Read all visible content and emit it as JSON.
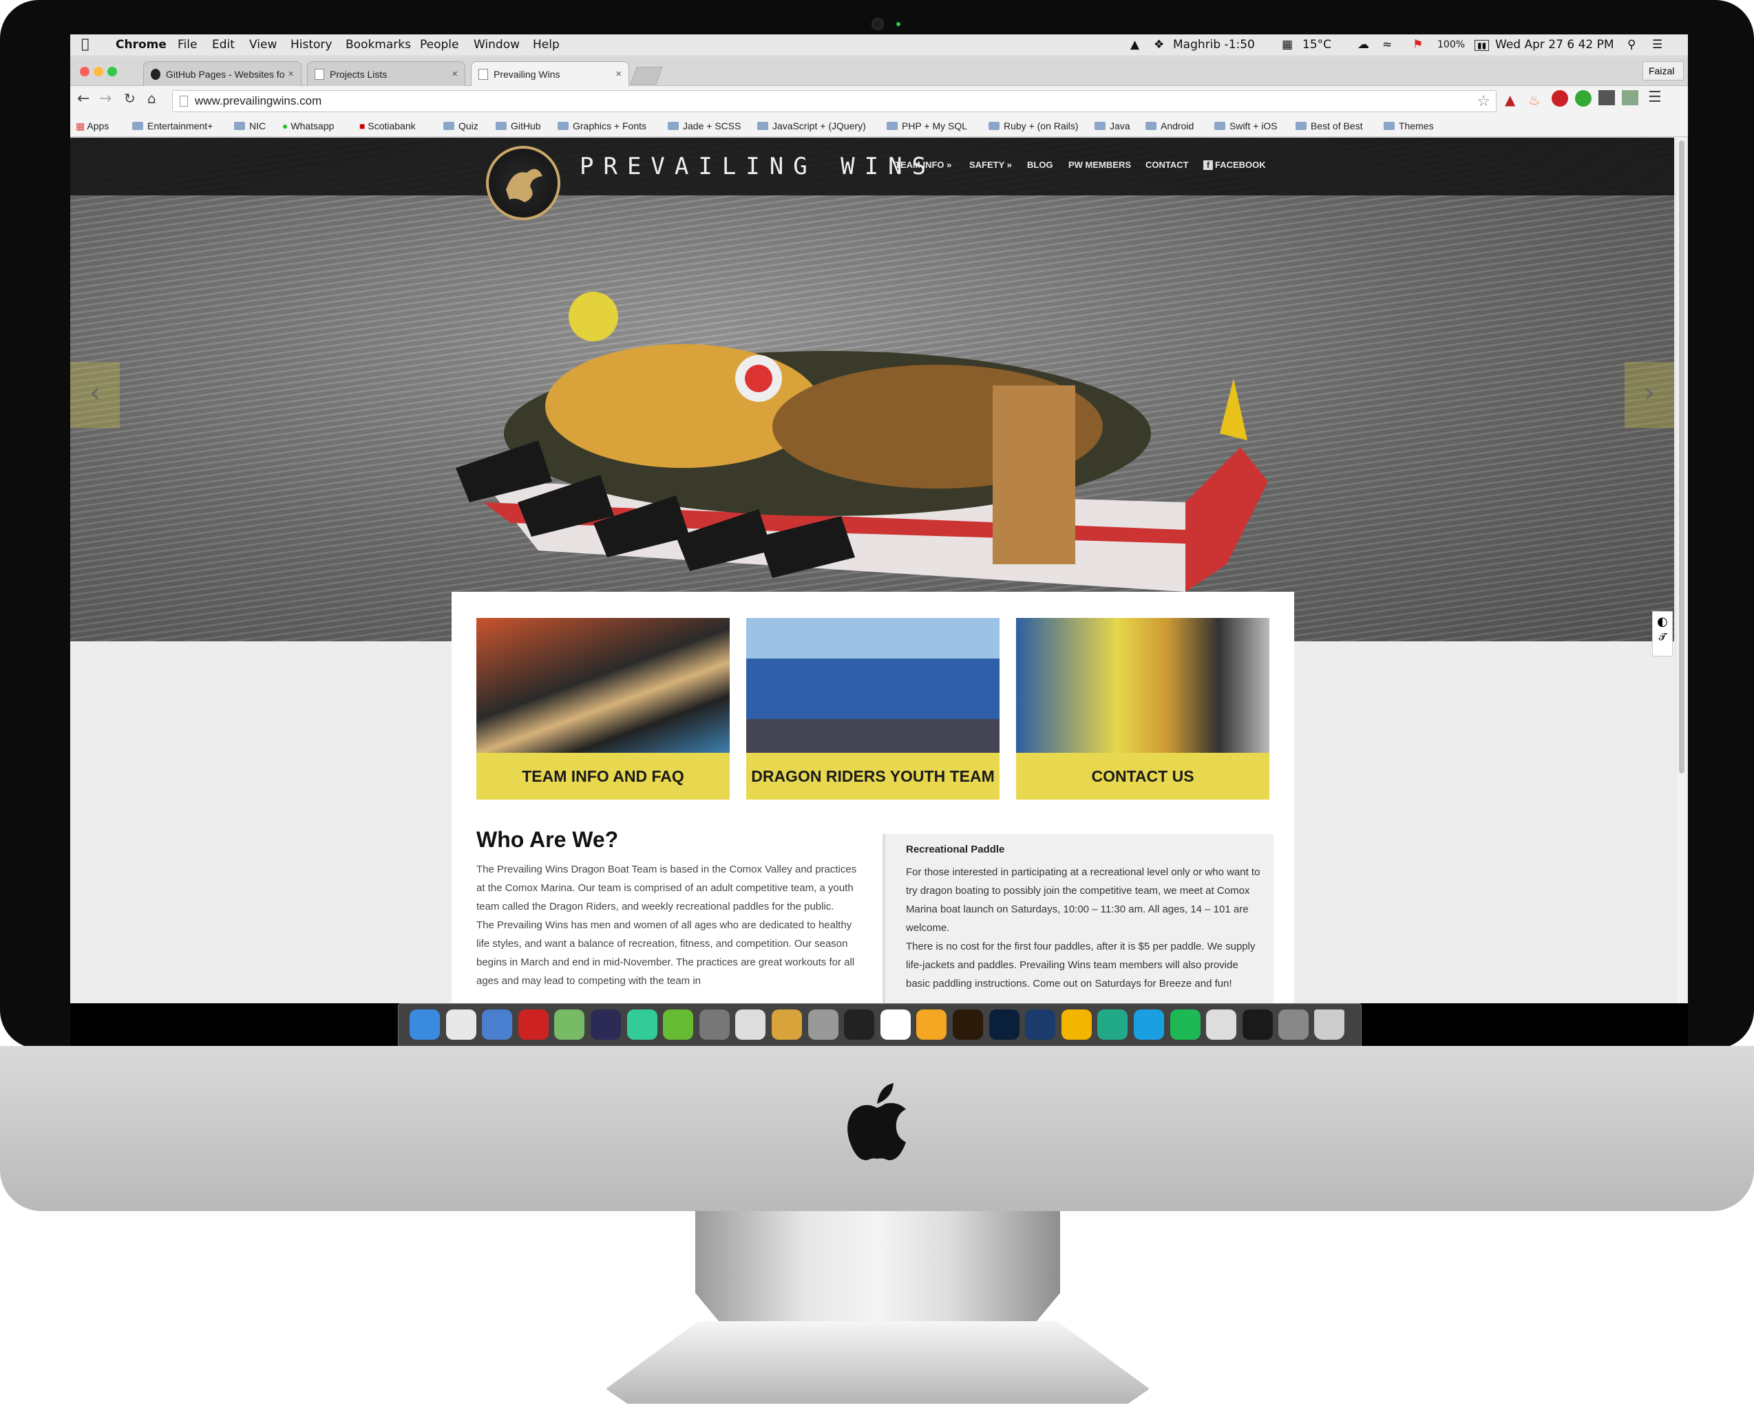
{
  "menubar": {
    "app": "Chrome",
    "menus": [
      "File",
      "Edit",
      "View",
      "History",
      "Bookmarks",
      "People",
      "Window",
      "Help"
    ],
    "prayer": "Maghrib -1:50",
    "weather": "15°C",
    "battery": "100%",
    "datetime": "Wed Apr 27  6 42 PM"
  },
  "tabs": [
    {
      "title": "GitHub Pages - Websites fo"
    },
    {
      "title": "Projects Lists"
    },
    {
      "title": "Prevailing Wins"
    }
  ],
  "profile": "Faizal",
  "address": "www.prevailingwins.com",
  "bookmarks": [
    "Apps",
    "Entertainment+",
    "NIC",
    "Whatsapp",
    "Scotiabank",
    "Quiz",
    "GitHub",
    "Graphics + Fonts",
    "Jade + SCSS",
    "JavaScript + (JQuery)",
    "PHP + My SQL",
    "Ruby + (on Rails)",
    "Java",
    "Android",
    "Swift + iOS",
    "Best of Best",
    "Themes"
  ],
  "site": {
    "name": "PREVAILING WINS",
    "nav": [
      "TEAM INFO »",
      "SAFETY »",
      "BLOG",
      "PW MEMBERS",
      "CONTACT",
      "FACEBOOK"
    ],
    "tiles": [
      "TEAM INFO AND FAQ",
      "DRAGON RIDERS YOUTH TEAM",
      "CONTACT US"
    ],
    "who_title": "Who Are We?",
    "who_p1": "The Prevailing Wins Dragon Boat Team is based in the Comox Valley and practices at the Comox Marina. Our team is comprised of an adult competitive team, a youth team called the Dragon Riders, and weekly recreational paddles for the public.",
    "who_p2": "The Prevailing Wins has men and women of all ages who are dedicated to healthy life styles, and want a balance of recreation, fitness, and competition. Our season begins in March and end in mid-November. The practices are great workouts for all ages and may lead to competing with the team in",
    "rec_title": "Recreational Paddle",
    "rec_p1": "For those interested in participating at a recreational level only or who want to try dragon boating to possibly join the competitive team, we meet at Comox Marina boat launch on Saturdays, 10:00 – 11:30 am. All ages, 14 – 101 are welcome.",
    "rec_p2": "There is no cost for the first four paddles, after it is $5 per paddle. We supply life-jackets and paddles. Prevailing Wins team members will also provide basic paddling instructions. Come out on Saturdays for Breeze and fun!"
  },
  "colors": {
    "accent": "#e8d84f",
    "gold": "#c9a86a"
  },
  "dock_icons": [
    "finder-icon",
    "chrome-icon",
    "xcode-icon",
    "cc-icon",
    "android-studio-icon",
    "eclipse-icon",
    "atom-icon",
    "leaf-icon",
    "sublime-icon",
    "sequel-icon",
    "stack-icon",
    "disk-icon",
    "terminal-icon",
    "code-icon",
    "sketch-icon",
    "illustrator-icon",
    "photoshop-icon",
    "cloud-icon",
    "butterfly-icon",
    "evernote-icon",
    "skype-icon",
    "spotify-icon",
    "itunes-icon",
    "rocket-icon",
    "launchpad-icon",
    "trash-icon"
  ]
}
